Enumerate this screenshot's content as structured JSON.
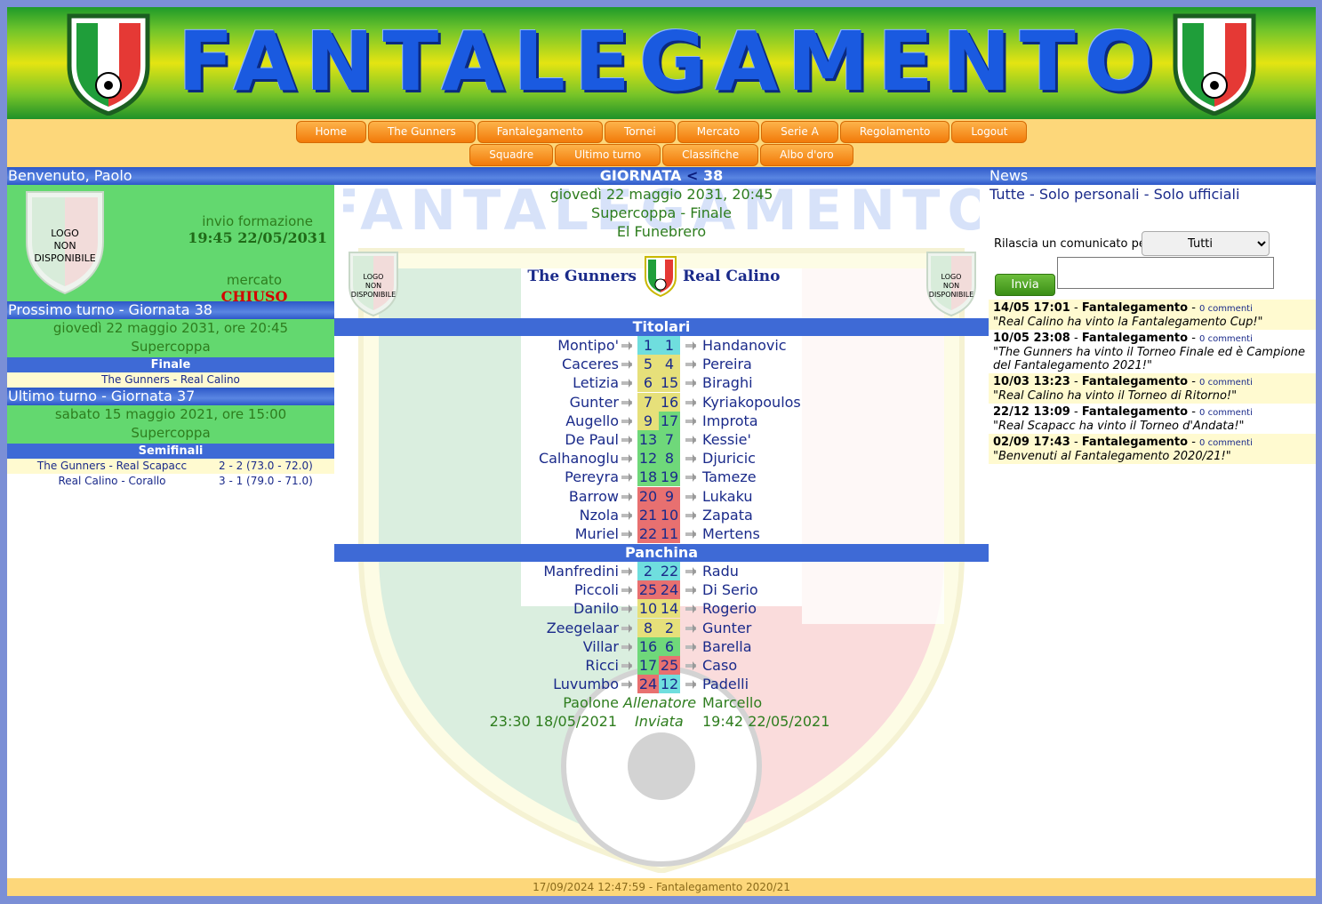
{
  "site": {
    "title": "FANTALEGAMENTO"
  },
  "menu": {
    "row1": [
      "Home",
      "The Gunners",
      "Fantalegamento",
      "Tornei",
      "Mercato",
      "Serie A",
      "Regolamento",
      "Logout"
    ],
    "row2": [
      "Squadre",
      "Ultimo turno",
      "Classifiche",
      "Albo d'oro"
    ]
  },
  "left": {
    "welcome": "Benvenuto, Paolo",
    "logo_text": [
      "LOGO",
      "NON",
      "DISPONIBILE"
    ],
    "invio_label": "invio formazione",
    "invio_time": "19:45 22/05/2031",
    "mercato_label": "mercato",
    "mercato_status": "CHIUSO",
    "next": {
      "header": "Prossimo turno - Giornata 38",
      "date": "giovedì 22 maggio 2031, ore 20:45",
      "comp": "Supercoppa",
      "phase": "Finale",
      "match": "The Gunners - Real Calino"
    },
    "last": {
      "header": "Ultimo turno - Giornata 37",
      "date": "sabato 15 maggio 2021, ore 15:00",
      "comp": "Supercoppa",
      "phase": "Semifinali",
      "results": [
        {
          "match": "The Gunners - Real Scapacc",
          "score": "2 - 2 (73.0 - 72.0)"
        },
        {
          "match": "Real Calino - Corallo",
          "score": "3 - 1 (79.0 - 71.0)"
        }
      ]
    }
  },
  "center": {
    "giornata_label": "GIORNATA",
    "giornata_prev": "<",
    "giornata_num": "38",
    "date": "giovedì 22 maggio 2031, 20:45",
    "comp": "Supercoppa - Finale",
    "stadium": "El Funebrero",
    "home": "The Gunners",
    "away": "Real Calino",
    "titolari_label": "Titolari",
    "panchina_label": "Panchina",
    "titolari": [
      {
        "h": "Montipo'",
        "hv": "1",
        "hc": "#6fdede",
        "av": "1",
        "ac": "#6fdede",
        "a": "Handanovic"
      },
      {
        "h": "Caceres",
        "hv": "5",
        "hc": "#e6e07a",
        "av": "4",
        "ac": "#e6e07a",
        "a": "Pereira"
      },
      {
        "h": "Letizia",
        "hv": "6",
        "hc": "#e6e07a",
        "av": "15",
        "ac": "#e6e07a",
        "a": "Biraghi"
      },
      {
        "h": "Gunter",
        "hv": "7",
        "hc": "#e6e07a",
        "av": "16",
        "ac": "#e6e07a",
        "a": "Kyriakopoulos"
      },
      {
        "h": "Augello",
        "hv": "9",
        "hc": "#e6e07a",
        "av": "17",
        "ac": "#6fd87a",
        "a": "Improta"
      },
      {
        "h": "De Paul",
        "hv": "13",
        "hc": "#6fd87a",
        "av": "7",
        "ac": "#6fd87a",
        "a": "Kessie'"
      },
      {
        "h": "Calhanoglu",
        "hv": "12",
        "hc": "#6fd87a",
        "av": "8",
        "ac": "#6fd87a",
        "a": "Djuricic"
      },
      {
        "h": "Pereyra",
        "hv": "18",
        "hc": "#6fd87a",
        "av": "19",
        "ac": "#6fd87a",
        "a": "Tameze"
      },
      {
        "h": "Barrow",
        "hv": "20",
        "hc": "#e87070",
        "av": "9",
        "ac": "#e87070",
        "a": "Lukaku"
      },
      {
        "h": "Nzola",
        "hv": "21",
        "hc": "#e87070",
        "av": "10",
        "ac": "#e87070",
        "a": "Zapata"
      },
      {
        "h": "Muriel",
        "hv": "22",
        "hc": "#e87070",
        "av": "11",
        "ac": "#e87070",
        "a": "Mertens"
      }
    ],
    "panchina": [
      {
        "h": "Manfredini",
        "hv": "2",
        "hc": "#6fdede",
        "av": "22",
        "ac": "#6fdede",
        "a": "Radu"
      },
      {
        "h": "Piccoli",
        "hv": "25",
        "hc": "#e87070",
        "av": "24",
        "ac": "#e87070",
        "a": "Di Serio"
      },
      {
        "h": "Danilo",
        "hv": "10",
        "hc": "#e6e07a",
        "av": "14",
        "ac": "#e6e07a",
        "a": "Rogerio"
      },
      {
        "h": "Zeegelaar",
        "hv": "8",
        "hc": "#e6e07a",
        "av": "2",
        "ac": "#e6e07a",
        "a": "Gunter"
      },
      {
        "h": "Villar",
        "hv": "16",
        "hc": "#6fd87a",
        "av": "6",
        "ac": "#6fd87a",
        "a": "Barella"
      },
      {
        "h": "Ricci",
        "hv": "17",
        "hc": "#6fd87a",
        "av": "25",
        "ac": "#e87070",
        "a": "Caso"
      },
      {
        "h": "Luvumbo",
        "hv": "24",
        "hc": "#e87070",
        "av": "12",
        "ac": "#6fdede",
        "a": "Padelli"
      }
    ],
    "coach_home": "Paolone",
    "coach_label": "Allenatore",
    "coach_away": "Marcello",
    "sent_home": "23:30 18/05/2021",
    "sent_label": "Inviata",
    "sent_away": "19:42 22/05/2021"
  },
  "right": {
    "header": "News",
    "filters": "Tutte - Solo personali - Solo ufficiali",
    "comunicato_label": "Rilascia un comunicato per",
    "select_value": "Tutti",
    "send_label": "Invia",
    "news": [
      {
        "date": "14/05 17:01",
        "author": "Fantalegamento",
        "comments": "0 commenti",
        "text": "\"Real Calino ha vinto la Fantalegamento Cup!\""
      },
      {
        "date": "10/05 23:08",
        "author": "Fantalegamento",
        "comments": "0 commenti",
        "text": "\"The Gunners ha vinto il Torneo Finale ed è Campione del Fantalegamento 2021!\""
      },
      {
        "date": "10/03 13:23",
        "author": "Fantalegamento",
        "comments": "0 commenti",
        "text": "\"Real Calino ha vinto il Torneo di Ritorno!\""
      },
      {
        "date": "22/12 13:09",
        "author": "Fantalegamento",
        "comments": "0 commenti",
        "text": "\"Real Scapacc ha vinto il Torneo d'Andata!\""
      },
      {
        "date": "02/09 17:43",
        "author": "Fantalegamento",
        "comments": "0 commenti",
        "text": "\"Benvenuti al Fantalegamento 2020/21!\""
      }
    ]
  },
  "footer": "17/09/2024 12:47:59 - Fantalegamento 2020/21"
}
